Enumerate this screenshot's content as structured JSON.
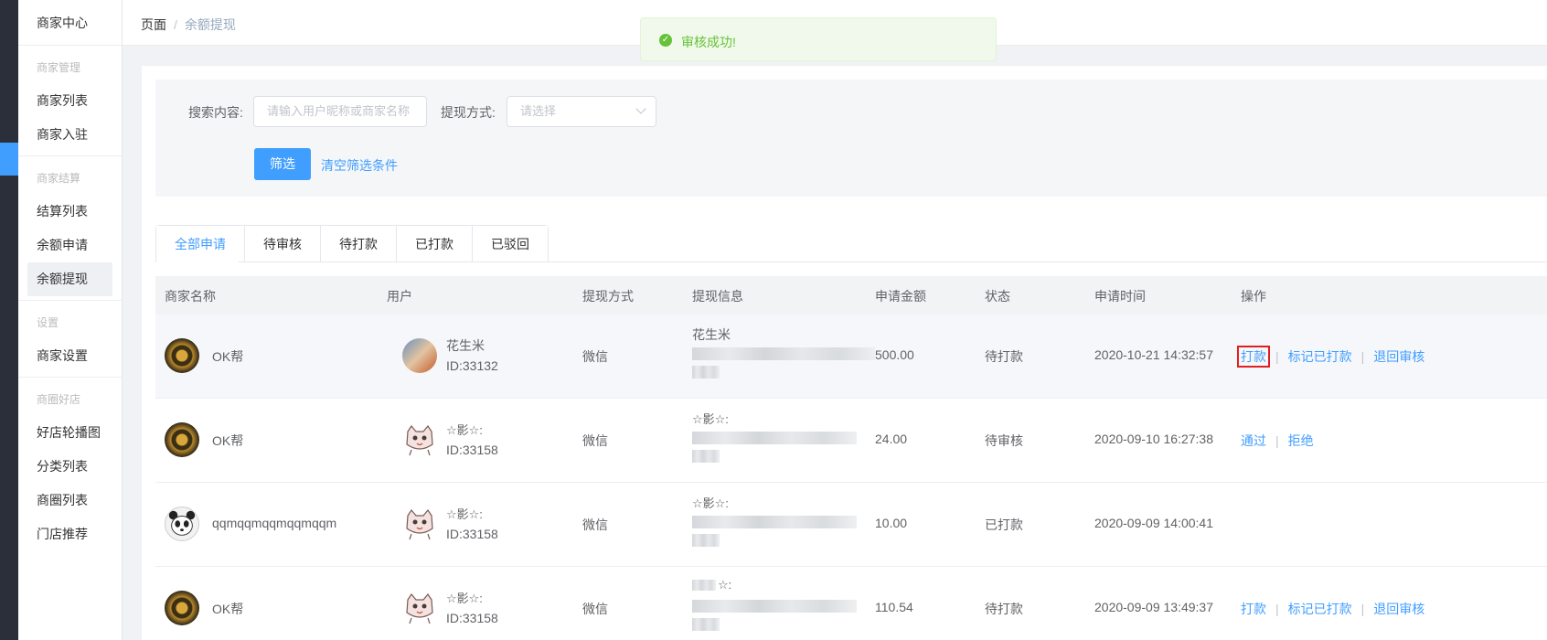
{
  "sidebar": {
    "header": "商家中心",
    "groups": [
      {
        "title": "商家管理",
        "items": [
          "商家列表",
          "商家入驻"
        ]
      },
      {
        "title": "商家结算",
        "items": [
          "结算列表",
          "余额申请",
          "余额提现"
        ]
      },
      {
        "title": "设置",
        "items": [
          "商家设置"
        ]
      },
      {
        "title": "商圈好店",
        "items": [
          "好店轮播图",
          "分类列表",
          "商圈列表",
          "门店推荐"
        ]
      }
    ],
    "active": "余额提现"
  },
  "breadcrumb": {
    "root": "页面",
    "sep": "/",
    "current": "余额提现"
  },
  "toast": {
    "message": "审核成功!"
  },
  "filter": {
    "search_label": "搜索内容:",
    "search_placeholder": "请输入用户昵称或商家名称",
    "method_label": "提现方式:",
    "method_placeholder": "请选择",
    "filter_button": "筛选",
    "clear_link": "清空筛选条件"
  },
  "tabs": [
    "全部申请",
    "待审核",
    "待打款",
    "已打款",
    "已驳回"
  ],
  "table": {
    "headers": [
      "商家名称",
      "用户",
      "提现方式",
      "提现信息",
      "申请金额",
      "状态",
      "申请时间",
      "操作"
    ],
    "rows": [
      {
        "merchant": "OK帮",
        "user_name": "花生米",
        "user_id": "ID:33132",
        "method": "微信",
        "info": "花生米",
        "amount": "500.00",
        "status": "待打款",
        "time": "2020-10-21 14:32:57",
        "ops": [
          "打款",
          "标记已打款",
          "退回审核"
        ]
      },
      {
        "merchant": "OK帮",
        "user_name": "☆影☆:",
        "user_id": "ID:33158",
        "method": "微信",
        "info": "☆影☆:",
        "amount": "24.00",
        "status": "待审核",
        "time": "2020-09-10 16:27:38",
        "ops": [
          "通过",
          "拒绝"
        ]
      },
      {
        "merchant": "qqmqqmqqmqqmqqm",
        "user_name": "☆影☆:",
        "user_id": "ID:33158",
        "method": "微信",
        "info": "☆影☆:",
        "amount": "10.00",
        "status": "已打款",
        "time": "2020-09-09 14:00:41",
        "ops": []
      },
      {
        "merchant": "OK帮",
        "user_name": "☆影☆:",
        "user_id": "ID:33158",
        "method": "微信",
        "info": "☆:",
        "amount": "110.54",
        "status": "待打款",
        "time": "2020-09-09 13:49:37",
        "ops": [
          "打款",
          "标记已打款",
          "退回审核"
        ]
      }
    ]
  },
  "colors": {
    "primary": "#409eff",
    "success": "#67c23a",
    "highlight": "#e02020"
  }
}
